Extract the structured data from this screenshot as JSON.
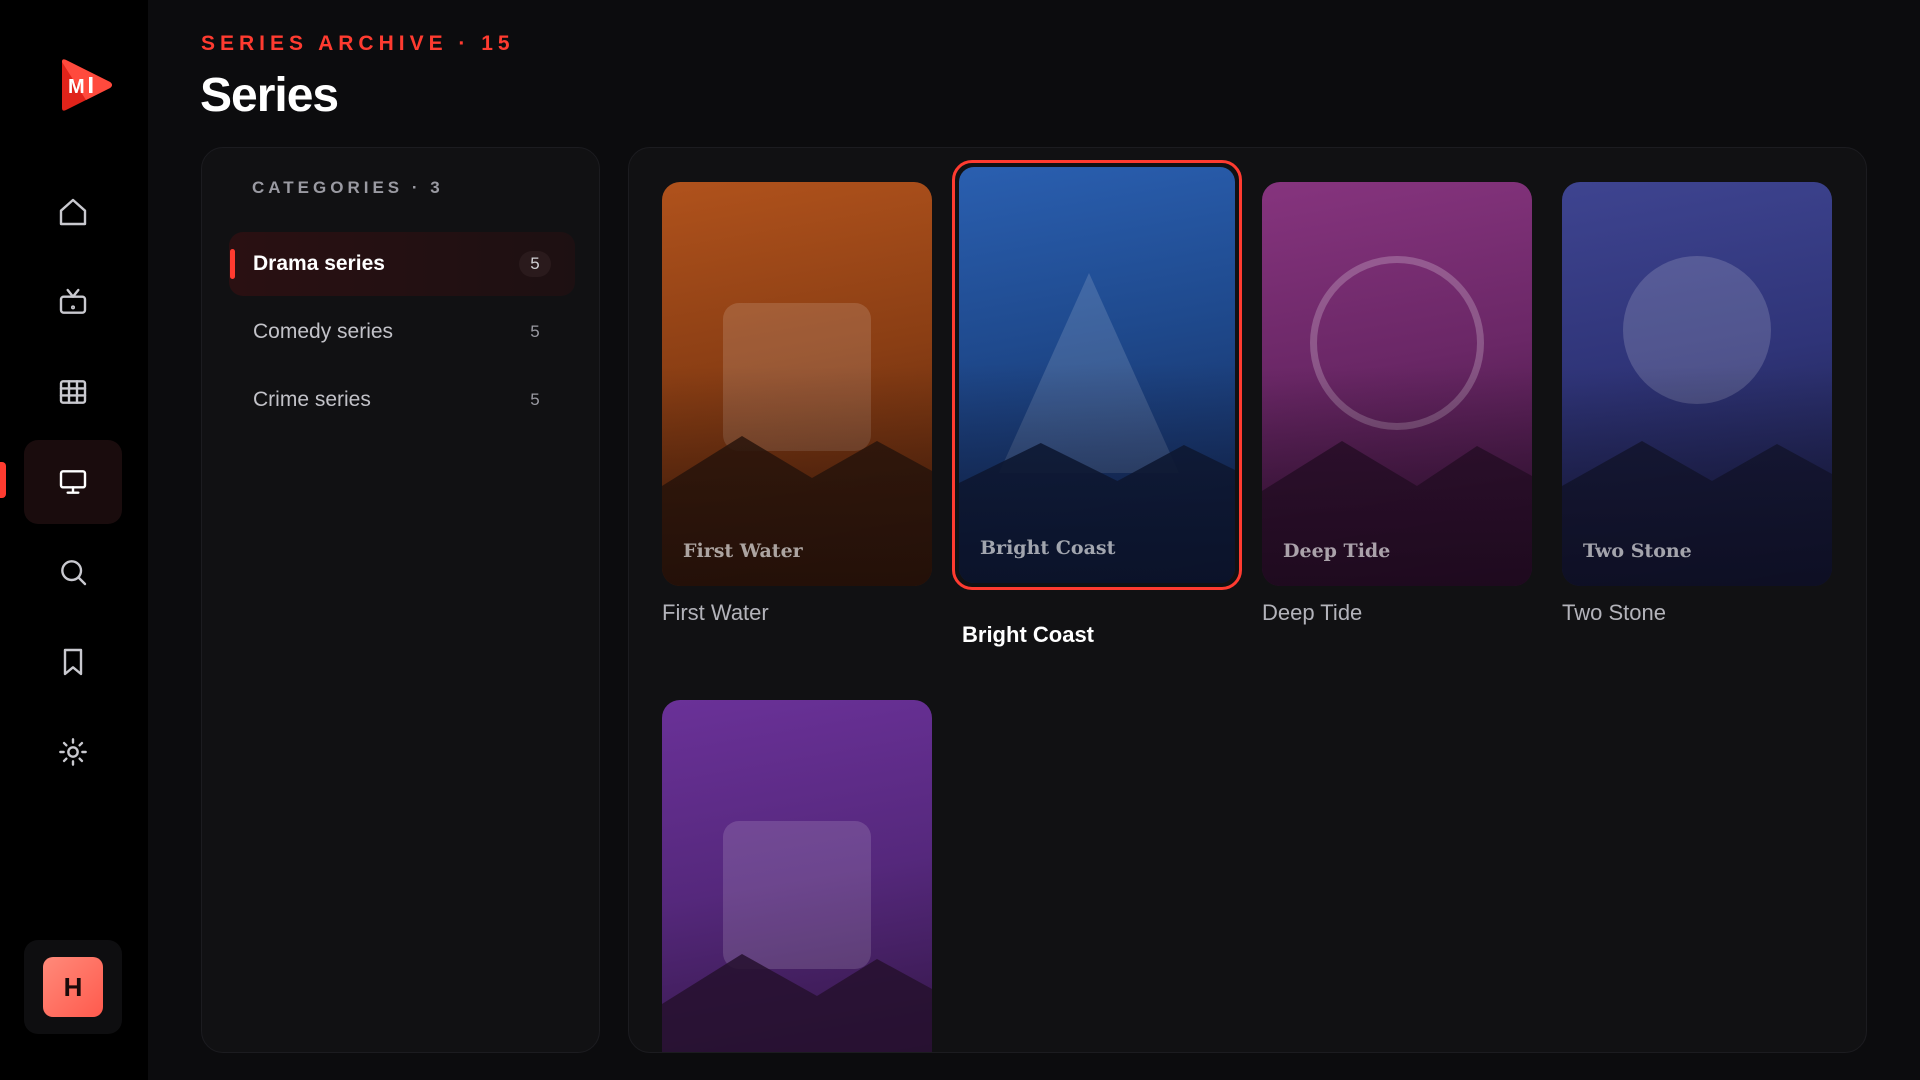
{
  "header": {
    "eyebrow": "SERIES ARCHIVE · 15",
    "title": "Series"
  },
  "rail": {
    "items": [
      {
        "icon": "home-icon",
        "active": false
      },
      {
        "icon": "tv-icon",
        "active": false
      },
      {
        "icon": "grid-icon",
        "active": false
      },
      {
        "icon": "monitor-icon",
        "active": true
      },
      {
        "icon": "search-icon",
        "active": false
      },
      {
        "icon": "bookmark-icon",
        "active": false
      },
      {
        "icon": "settings-icon",
        "active": false
      }
    ],
    "avatar_initial": "H"
  },
  "categories": {
    "heading": "CATEGORIES · 3",
    "items": [
      {
        "label": "Drama series",
        "count": "5",
        "active": true
      },
      {
        "label": "Comedy series",
        "count": "5",
        "active": false
      },
      {
        "label": "Crime series",
        "count": "5",
        "active": false
      }
    ]
  },
  "cards": [
    {
      "title": "First Water",
      "caption": "First Water",
      "shape": "square",
      "focused": false
    },
    {
      "title": "Bright Coast",
      "caption": "Bright Coast",
      "shape": "triangle",
      "focused": true
    },
    {
      "title": "Deep Tide",
      "caption": "Deep Tide",
      "shape": "ring",
      "focused": false
    },
    {
      "title": "Two Stone",
      "caption": "Two Stone",
      "shape": "disc",
      "focused": false
    },
    {
      "title": "",
      "caption": "",
      "shape": "square",
      "focused": false
    }
  ],
  "colors": {
    "accent": "#ff3b30",
    "rail_bg": "#000000",
    "page_bg": "#0c0c0e",
    "panel_bg": "#111113"
  }
}
